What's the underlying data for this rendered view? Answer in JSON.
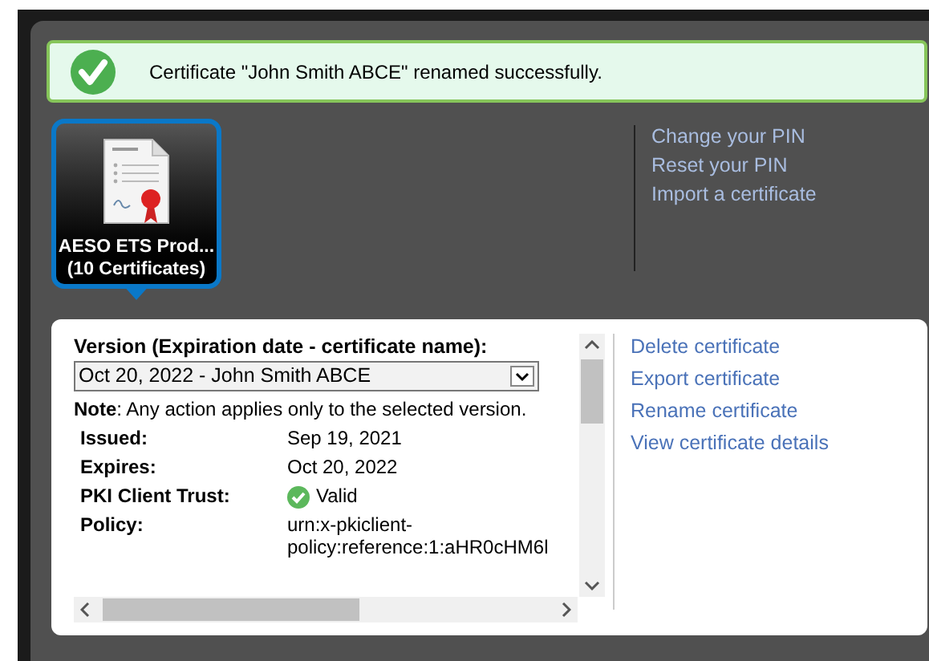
{
  "alert": {
    "message": "Certificate \"John Smith ABCE\" renamed successfully."
  },
  "token": {
    "name": "AESO ETS Prod...",
    "count": "(10 Certificates)",
    "selected": true
  },
  "token_actions": [
    "Change your PIN",
    "Reset your PIN",
    "Import a certificate"
  ],
  "details": {
    "version_label": "Version (Expiration date - certificate name):",
    "version_value": "Oct 20, 2022 - John Smith ABCE",
    "note": "**Note**: Any action applies only to the selected version.",
    "fields": [
      {
        "label": "Issued:",
        "value": "Sep 19, 2021",
        "kind": "text"
      },
      {
        "label": "Expires:",
        "value": "Oct 20, 2022",
        "kind": "text"
      },
      {
        "label": "PKI Client Trust:",
        "value": "Valid",
        "kind": "status"
      },
      {
        "label": "Policy:",
        "value": "urn:x-pkiclient-policy:reference:1:aHR0cHM6l",
        "kind": "text"
      }
    ]
  },
  "certificate_actions": [
    "Delete certificate",
    "Export certificate",
    "Rename certificate",
    "View certificate details"
  ]
}
